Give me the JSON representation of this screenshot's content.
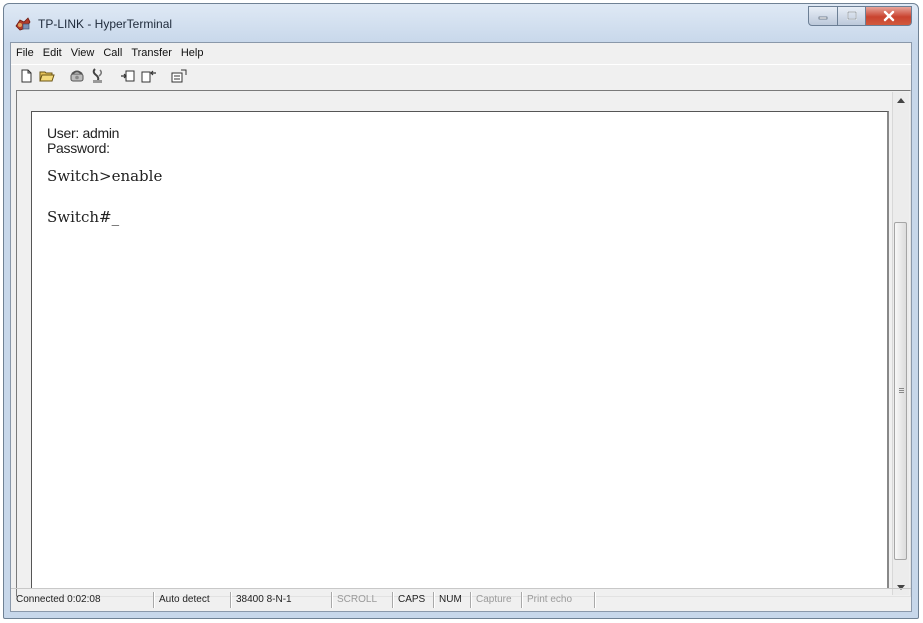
{
  "window": {
    "title": "TP-LINK - HyperTerminal"
  },
  "menu": [
    "File",
    "Edit",
    "View",
    "Call",
    "Transfer",
    "Help"
  ],
  "toolbar": {
    "icons": [
      "new-document-icon",
      "open-folder-icon",
      "connect-phone-icon",
      "disconnect-phone-icon",
      "send-file-icon",
      "receive-file-icon",
      "properties-icon"
    ]
  },
  "terminal": {
    "lines": [
      "User: admin",
      "Password:",
      "Switch>enable",
      "Switch#_"
    ]
  },
  "status": {
    "connected": "Connected 0:02:08",
    "detect": "Auto detect",
    "port": "38400 8-N-1",
    "scroll": "SCROLL",
    "caps": "CAPS",
    "num": "NUM",
    "capture": "Capture",
    "echo": "Print echo"
  },
  "colors": {
    "title_bar": "#c7d7ea",
    "close_button": "#c9432f",
    "terminal_bg": "#ffffff"
  }
}
